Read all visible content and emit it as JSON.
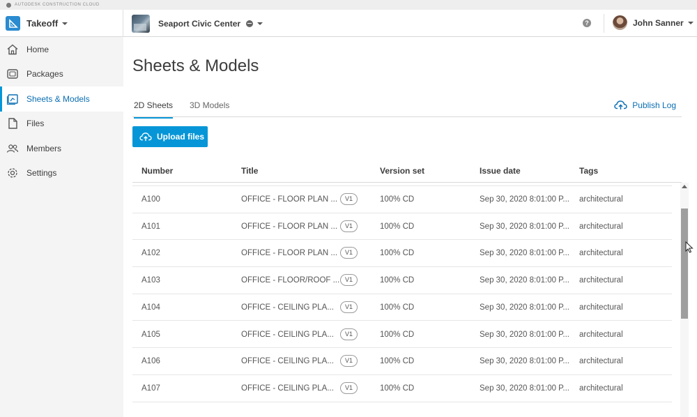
{
  "brand": {
    "text": "AUTODESK CONSTRUCTION CLOUD"
  },
  "header": {
    "app_name": "Takeoff",
    "project_name": "Seaport Civic Center",
    "help_label": "?",
    "user_name": "John Sanner"
  },
  "sidebar": {
    "items": [
      {
        "label": "Home",
        "icon": "home-icon"
      },
      {
        "label": "Packages",
        "icon": "packages-icon"
      },
      {
        "label": "Sheets & Models",
        "icon": "sheets-icon",
        "active": true
      },
      {
        "label": "Files",
        "icon": "file-icon"
      },
      {
        "label": "Members",
        "icon": "members-icon"
      },
      {
        "label": "Settings",
        "icon": "gear-icon"
      }
    ]
  },
  "main": {
    "title": "Sheets & Models",
    "tabs": [
      {
        "label": "2D Sheets",
        "active": true
      },
      {
        "label": "3D Models",
        "active": false
      }
    ],
    "publish_log": "Publish Log",
    "upload_label": "Upload files",
    "table": {
      "columns": [
        "Number",
        "Title",
        "Version set",
        "Issue date",
        "Tags"
      ],
      "rows": [
        {
          "number": "A100",
          "title": "OFFICE - FLOOR PLAN ...",
          "version": "V1",
          "version_set": "100% CD",
          "issue_date": "Sep 30, 2020 8:01:00 P...",
          "tags": "architectural"
        },
        {
          "number": "A101",
          "title": "OFFICE - FLOOR PLAN ...",
          "version": "V1",
          "version_set": "100% CD",
          "issue_date": "Sep 30, 2020 8:01:00 P...",
          "tags": "architectural"
        },
        {
          "number": "A102",
          "title": "OFFICE - FLOOR PLAN ...",
          "version": "V1",
          "version_set": "100% CD",
          "issue_date": "Sep 30, 2020 8:01:00 P...",
          "tags": "architectural"
        },
        {
          "number": "A103",
          "title": "OFFICE - FLOOR/ROOF ...",
          "version": "V1",
          "version_set": "100% CD",
          "issue_date": "Sep 30, 2020 8:01:00 P...",
          "tags": "architectural"
        },
        {
          "number": "A104",
          "title": "OFFICE - CEILING PLA...",
          "version": "V1",
          "version_set": "100% CD",
          "issue_date": "Sep 30, 2020 8:01:00 P...",
          "tags": "architectural"
        },
        {
          "number": "A105",
          "title": "OFFICE - CEILING PLA...",
          "version": "V1",
          "version_set": "100% CD",
          "issue_date": "Sep 30, 2020 8:01:00 P...",
          "tags": "architectural"
        },
        {
          "number": "A106",
          "title": "OFFICE - CEILING PLA...",
          "version": "V1",
          "version_set": "100% CD",
          "issue_date": "Sep 30, 2020 8:01:00 P...",
          "tags": "architectural"
        },
        {
          "number": "A107",
          "title": "OFFICE - CEILING PLA...",
          "version": "V1",
          "version_set": "100% CD",
          "issue_date": "Sep 30, 2020 8:01:00 P...",
          "tags": "architectural"
        }
      ]
    }
  },
  "colors": {
    "accent": "#0696d7",
    "link": "#0a6fb3",
    "sidebar_bg": "#f4f4f4",
    "text": "#3c3c3c"
  }
}
